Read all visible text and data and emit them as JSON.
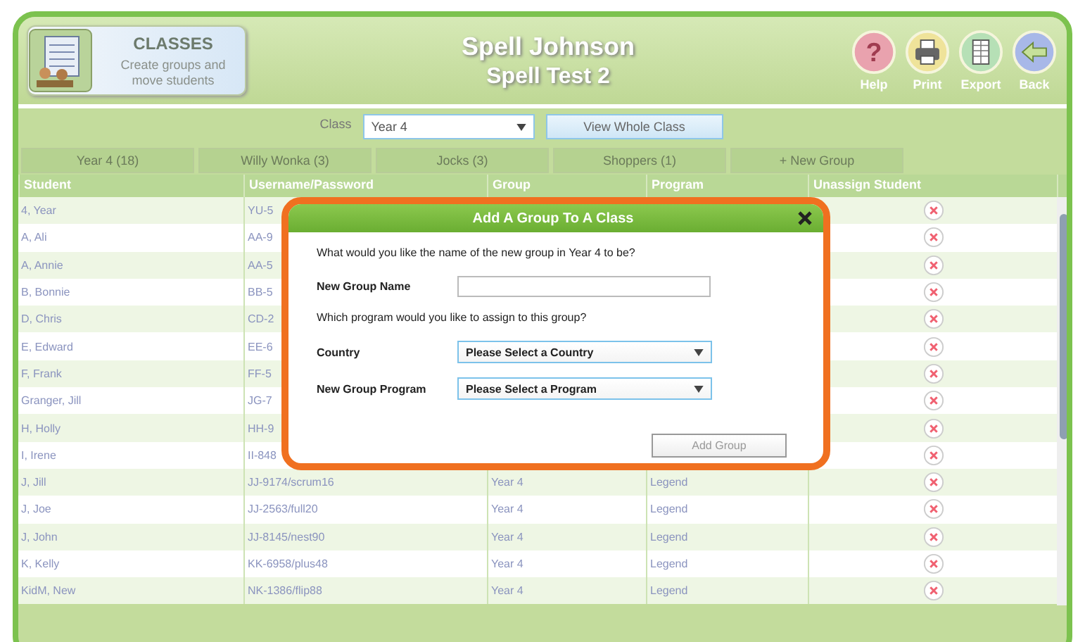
{
  "header": {
    "section_title": "CLASSES",
    "section_subtitle": "Create groups and move students",
    "title": "Spell Johnson",
    "subtitle": "Spell Test 2",
    "actions": [
      {
        "kind": "help",
        "label": "Help",
        "glyph": "?"
      },
      {
        "kind": "print",
        "label": "Print"
      },
      {
        "kind": "export",
        "label": "Export"
      },
      {
        "kind": "back",
        "label": "Back"
      }
    ]
  },
  "class_filter": {
    "label": "Class",
    "value": "Year 4",
    "button": "View Whole Class"
  },
  "tabs": [
    {
      "label": "Year 4 (18)",
      "selected": false
    },
    {
      "label": "Willy Wonka (3)",
      "selected": false
    },
    {
      "label": "Jocks (3)",
      "selected": false
    },
    {
      "label": "Shoppers (1)",
      "selected": false
    },
    {
      "label": "+ New Group",
      "selected": false
    }
  ],
  "table": {
    "columns": [
      "Student",
      "Username/Password",
      "Group",
      "Program",
      "Unassign Student"
    ],
    "rows": [
      {
        "student": "4, Year",
        "username": "YU-5"
      },
      {
        "student": "A, Ali",
        "username": "AA-9"
      },
      {
        "student": "A, Annie",
        "username": "AA-5"
      },
      {
        "student": "B, Bonnie",
        "username": "BB-5"
      },
      {
        "student": "D, Chris",
        "username": "CD-2"
      },
      {
        "student": "E, Edward",
        "username": "EE-6"
      },
      {
        "student": "F, Frank",
        "username": "FF-5"
      },
      {
        "student": "Granger, Jill",
        "username": "JG-7"
      },
      {
        "student": "H, Holly",
        "username": "HH-9"
      },
      {
        "student": "I, Irene",
        "username": "II-848"
      },
      {
        "student": "J, Jill",
        "username": "JJ-9174/scrum16",
        "group": "Year 4",
        "program": "Legend"
      },
      {
        "student": "J, Joe",
        "username": "JJ-2563/full20",
        "group": "Year 4",
        "program": "Legend"
      },
      {
        "student": "J, John",
        "username": "JJ-8145/nest90",
        "group": "Year 4",
        "program": "Legend"
      },
      {
        "student": "K, Kelly",
        "username": "KK-6958/plus48",
        "group": "Year 4",
        "program": "Legend"
      },
      {
        "student": "KidM, New",
        "username": "NK-1386/flip88",
        "group": "Year 4",
        "program": "Legend"
      }
    ]
  },
  "dialog": {
    "title": "Add A Group To A Class",
    "question": "What would you like the name of the new group in Year 4 to be?",
    "name_label": "New Group Name",
    "program_question": "Which program would you like to assign to this group?",
    "selects": [
      {
        "label": "Country",
        "value": "Please Select a Country"
      },
      {
        "label": "New Group Program",
        "value": "Please Select a Program"
      }
    ],
    "submit": {
      "label": "Add Group",
      "disabled": true
    }
  }
}
